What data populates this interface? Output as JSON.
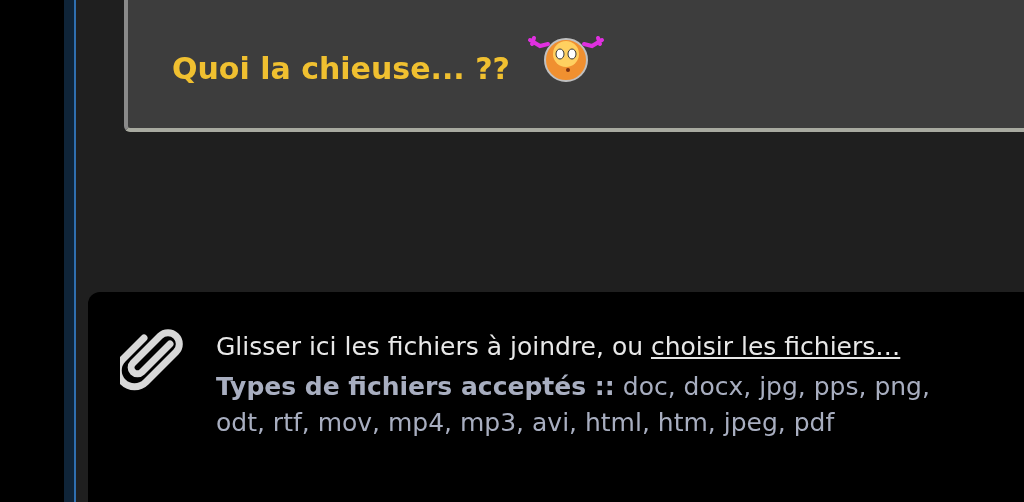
{
  "quote": {
    "text": "Quoi la chieuse... ??"
  },
  "attachments": {
    "prompt": "Glisser ici les fichiers à joindre, ou",
    "link": "choisir les fichiers…",
    "types_label": "Types de fichiers acceptés ::",
    "types_lines": [
      "doc, docx, jpg, pps, png,",
      "odt, rtf, mov, mp4, mp3, avi, html, htm, jpeg, pdf"
    ]
  }
}
